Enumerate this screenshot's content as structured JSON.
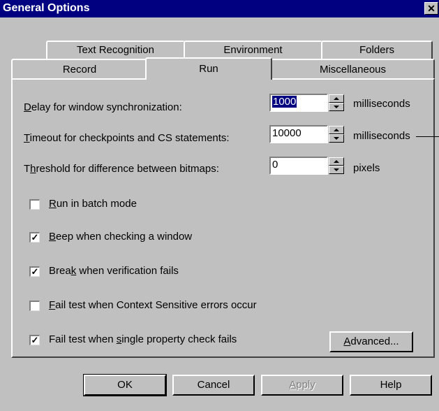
{
  "window": {
    "title": "General Options",
    "close_label": "✕"
  },
  "tabs": {
    "back": [
      "Text Recognition",
      "Environment",
      "Folders"
    ],
    "front": [
      "Record",
      "Run",
      "Miscellaneous"
    ],
    "selected": "Run"
  },
  "settings": {
    "delay": {
      "label_pre": "",
      "label_key": "D",
      "label_post": "elay for window synchronization:",
      "value": "1000",
      "unit": "milliseconds"
    },
    "timeout": {
      "label_pre": "",
      "label_key": "T",
      "label_post": "imeout for checkpoints and CS statements:",
      "value": "10000",
      "unit": "milliseconds"
    },
    "threshold": {
      "label_pre": "T",
      "label_key": "h",
      "label_post": "reshold for difference between bitmaps:",
      "value": "0",
      "unit": "pixels"
    }
  },
  "checkboxes": [
    {
      "pre": "",
      "key": "R",
      "post": "un in batch mode",
      "checked": false,
      "mark": ""
    },
    {
      "pre": "",
      "key": "B",
      "post": "eep when checking a window",
      "checked": true,
      "mark": "✓"
    },
    {
      "pre": "Brea",
      "key": "k",
      "post": " when verification fails",
      "checked": true,
      "mark": "✓"
    },
    {
      "pre": "",
      "key": "F",
      "post": "ail test when Context Sensitive errors occur",
      "checked": false,
      "mark": ""
    },
    {
      "pre": "Fail test when ",
      "key": "s",
      "post": "ingle property check fails",
      "checked": true,
      "mark": "✓"
    }
  ],
  "buttons": {
    "advanced": {
      "key": "A",
      "post": "dvanced..."
    },
    "ok": "OK",
    "cancel": "Cancel",
    "apply": {
      "key": "A",
      "post": "pply"
    },
    "help": "Help"
  }
}
